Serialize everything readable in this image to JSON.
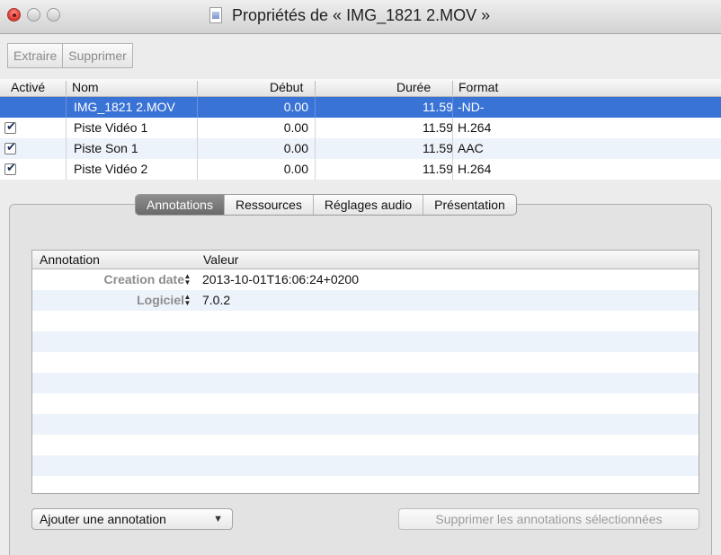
{
  "window": {
    "title": "Propriétés de « IMG_1821 2.MOV »"
  },
  "toolbar": {
    "extract_label": "Extraire",
    "delete_label": "Supprimer"
  },
  "tracks": {
    "columns": [
      "Activé",
      "Nom",
      "Début",
      "Durée",
      "Format"
    ],
    "rows": [
      {
        "enabled": false,
        "name": "IMG_1821 2.MOV",
        "start": "0.00",
        "duration": "11.59",
        "format": "-ND-",
        "selected": true
      },
      {
        "enabled": true,
        "name": "Piste Vidéo 1",
        "start": "0.00",
        "duration": "11.59",
        "format": "H.264",
        "selected": false
      },
      {
        "enabled": true,
        "name": "Piste Son 1",
        "start": "0.00",
        "duration": "11.59",
        "format": "AAC",
        "selected": false
      },
      {
        "enabled": true,
        "name": "Piste Vidéo 2",
        "start": "0.00",
        "duration": "11.59",
        "format": "H.264",
        "selected": false
      }
    ]
  },
  "tabs": [
    {
      "label": "Annotations",
      "active": true
    },
    {
      "label": "Ressources",
      "active": false
    },
    {
      "label": "Réglages audio",
      "active": false
    },
    {
      "label": "Présentation",
      "active": false
    }
  ],
  "annotations": {
    "columns": [
      "Annotation",
      "Valeur"
    ],
    "rows": [
      {
        "key": "Creation date",
        "value": "2013-10-01T16:06:24+0200"
      },
      {
        "key": "Logiciel",
        "value": "7.0.2"
      }
    ]
  },
  "buttons": {
    "add_annotation": "Ajouter une annotation",
    "delete_annotations": "Supprimer les annotations sélectionnées"
  },
  "colors": {
    "selection": "#3a73d6",
    "alt_row": "#edf3fb",
    "active_tab": "#7c7c7c"
  }
}
